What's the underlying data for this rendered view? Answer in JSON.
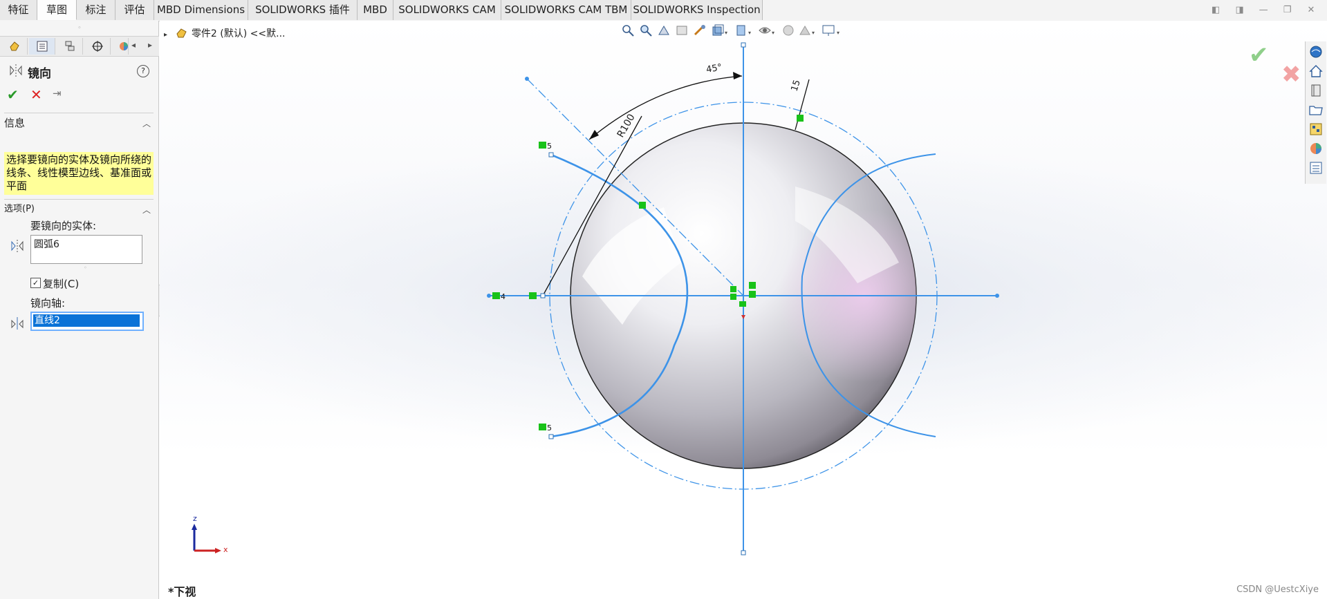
{
  "ribbon": {
    "tabs": [
      "特征",
      "草图",
      "标注",
      "评估",
      "MBD Dimensions",
      "SOLIDWORKS 插件",
      "MBD",
      "SOLIDWORKS CAM",
      "SOLIDWORKS CAM TBM",
      "SOLIDWORKS Inspection"
    ],
    "active_tab": "草图"
  },
  "property_manager": {
    "title": "镜向",
    "info_header": "信息",
    "info_text": "选择要镜向的实体及镜向所绕的线条、线性模型边线、基准面或平面",
    "options_header": "选项(P)",
    "entities_label": "要镜向的实体:",
    "entities_value": "圆弧6",
    "copy_label": "复制(C)",
    "copy_checked": true,
    "axis_label": "镜向轴:",
    "axis_value": "直线2"
  },
  "graphics": {
    "feature_tree_item": "零件2 (默认) <<默...",
    "view_name": "*下视",
    "dimension_angle": "45°",
    "dimension_radius": "R100",
    "dimension_offset": "15",
    "axis_z_label": "z",
    "axis_x_label": "x",
    "watermark": "CSDN @UestcXiye"
  },
  "colors": {
    "sketch_blue": "#3d93e8",
    "relation_green": "#19c219",
    "info_yellow": "#ffff99",
    "selection_blue": "#0a72d7"
  }
}
